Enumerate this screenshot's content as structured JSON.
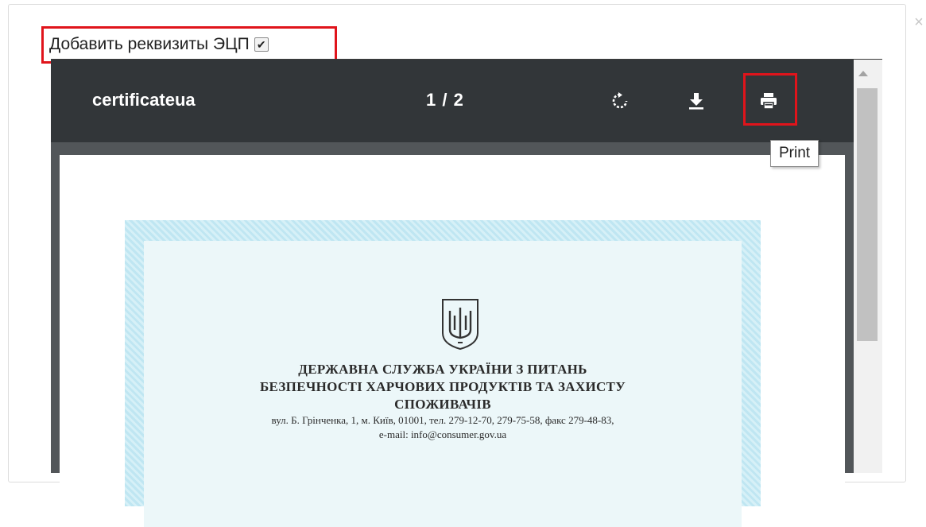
{
  "dialog": {
    "close_glyph": "×",
    "ecp": {
      "label": "Добавить реквизиты ЭЦП",
      "checked": true,
      "check_glyph": "✔"
    }
  },
  "viewer": {
    "title": "certificateua",
    "page_counter": "1 / 2",
    "buttons": {
      "rotate_icon": "rotate-icon",
      "download_icon": "download-icon",
      "print_icon": "print-icon"
    },
    "tooltip": "Print"
  },
  "certificate": {
    "emblem_icon": "tryzub-icon",
    "line1": "ДЕРЖАВНА СЛУЖБА УКРАЇНИ З ПИТАНЬ",
    "line2": "БЕЗПЕЧНОСТІ ХАРЧОВИХ ПРОДУКТІВ ТА ЗАХИСТУ",
    "line3": "СПОЖИВАЧІВ",
    "address": "вул. Б. Грінченка, 1, м. Київ, 01001, тел. 279-12-70, 279-75-58, факс 279-48-83,",
    "email": "e-mail: info@consumer.gov.ua"
  },
  "colors": {
    "highlight": "#e0141b",
    "toolbar": "#323639",
    "viewer_bg": "#525659"
  }
}
